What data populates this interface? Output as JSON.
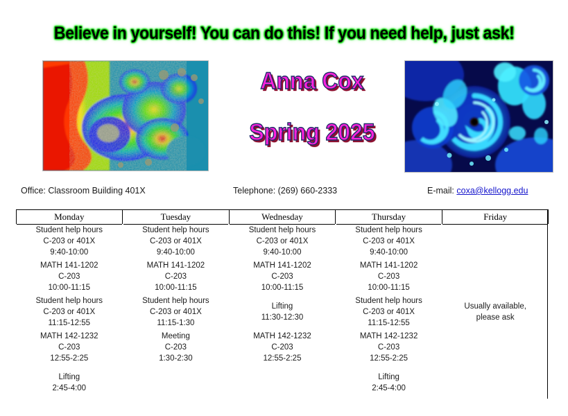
{
  "banner": {
    "text": "Believe in yourself!  You can do this!  If you need help, just ask!",
    "color": "#000000",
    "glow_color": "#2bea2b"
  },
  "wordart": {
    "name": "Anna Cox",
    "term": "Spring 2025",
    "fill_color": "#ff22dd",
    "outline_color": "#1e2a66",
    "shadow_color": "#8c1030"
  },
  "images": {
    "left": {
      "name": "rainbow-mandelbrot-fractal"
    },
    "right": {
      "name": "blue-julia-spiral-fractal"
    }
  },
  "contact": {
    "office": "Office: Classroom Building 401X",
    "telephone": "Telephone: (269) 660-2333",
    "email_label": "E-mail:",
    "email": "coxa@kellogg.edu",
    "email_color": "#1414cc"
  },
  "schedule": {
    "headers": [
      "Monday",
      "Tuesday",
      "Wednesday",
      "Thursday",
      "Friday"
    ],
    "colors": {
      "yellow": "#ffff00",
      "blue": "#b8cce4",
      "orange": "#fac975",
      "green": "#c3d9b0",
      "red": "#f79a93",
      "magenta": "#ff00ff",
      "empty": "#ffffff"
    },
    "rows": [
      {
        "cells": [
          {
            "color": "yellow",
            "lines": [
              "Student help hours",
              "C-203 or 401X",
              "9:40-10:00"
            ]
          },
          {
            "color": "yellow",
            "lines": [
              "Student help hours",
              "C-203 or 401X",
              "9:40-10:00"
            ]
          },
          {
            "color": "yellow",
            "lines": [
              "Student help hours",
              "C-203 or 401X",
              "9:40-10:00"
            ]
          },
          {
            "color": "yellow",
            "lines": [
              "Student help hours",
              "C-203 or 401X",
              "9:40-10:00"
            ]
          },
          {
            "color": "empty",
            "lines": []
          }
        ]
      },
      {
        "cells": [
          {
            "color": "blue",
            "lines": [
              "MATH 141-1202",
              "C-203",
              "10:00-11:15"
            ]
          },
          {
            "color": "blue",
            "lines": [
              "MATH 141-1202",
              "C-203",
              "10:00-11:15"
            ]
          },
          {
            "color": "blue",
            "lines": [
              "MATH 141-1202",
              "C-203",
              "10:00-11:15"
            ]
          },
          {
            "color": "blue",
            "lines": [
              "MATH 141-1202",
              "C-203",
              "10:00-11:15"
            ]
          },
          {
            "color": "empty",
            "lines": []
          }
        ]
      },
      {
        "cells": [
          {
            "color": "yellow",
            "lines": [
              "Student help hours",
              "C-203 or 401X",
              "11:15-12:55"
            ]
          },
          {
            "color": "yellow",
            "lines": [
              "Student help hours",
              "C-203 or 401X",
              "11:15-1:30"
            ]
          },
          {
            "color": "orange",
            "lines": [
              "Lifting",
              "11:30-12:30"
            ]
          },
          {
            "color": "yellow",
            "lines": [
              "Student help hours",
              "C-203 or 401X",
              "11:15-12:55"
            ]
          },
          {
            "color": "magenta",
            "lines": [
              "Usually available,",
              "please ask"
            ]
          }
        ]
      },
      {
        "cells": [
          {
            "color": "green",
            "lines": [
              "MATH 142-1232",
              "C-203",
              "12:55-2:25"
            ]
          },
          {
            "color": "red",
            "lines": [
              "Meeting",
              "C-203",
              "1:30-2:30"
            ]
          },
          {
            "color": "green",
            "lines": [
              "MATH 142-1232",
              "C-203",
              "12:55-2:25"
            ]
          },
          {
            "color": "green",
            "lines": [
              "MATH 142-1232",
              "C-203",
              "12:55-2:25"
            ]
          },
          {
            "color": "empty",
            "lines": []
          }
        ]
      },
      {
        "cells": [
          {
            "color": "orange",
            "lines": [
              "Lifting",
              "2:45-4:00"
            ]
          },
          {
            "color": "empty",
            "lines": []
          },
          {
            "color": "empty",
            "lines": []
          },
          {
            "color": "orange",
            "lines": [
              "Lifting",
              "2:45-4:00"
            ]
          },
          {
            "color": "empty",
            "lines": []
          }
        ]
      }
    ]
  }
}
